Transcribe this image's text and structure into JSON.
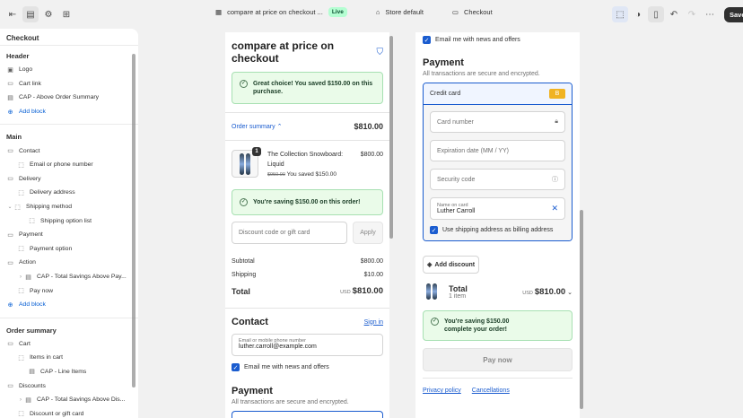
{
  "topbar": {
    "theme_title": "compare at price on checkout ...",
    "live_badge": "Live",
    "store_label": "Store default",
    "page_label": "Checkout",
    "save_label": "Save"
  },
  "sidebar": {
    "title": "Checkout",
    "header_section": "Header",
    "header_items": [
      "Logo",
      "Cart link",
      "CAP - Above Order Summary"
    ],
    "add_block": "Add block",
    "main_section": "Main",
    "contact": "Contact",
    "email_or_phone": "Email or phone number",
    "delivery": "Delivery",
    "delivery_address": "Delivery address",
    "shipping_method": "Shipping method",
    "shipping_option_list": "Shipping option list",
    "payment": "Payment",
    "payment_option": "Payment option",
    "action": "Action",
    "cap_total_above_pay": "CAP - Total Savings Above Pay...",
    "pay_now": "Pay now",
    "order_summary_section": "Order summary",
    "cart": "Cart",
    "items_in_cart": "Items in cart",
    "cap_line_items": "CAP - Line Items",
    "discounts": "Discounts",
    "cap_total_above_dis": "CAP - Total Savings Above Dis...",
    "discount_or_gift": "Discount or gift card"
  },
  "preview_left": {
    "shop_title": "compare at price on checkout",
    "great_choice": "Great choice! You saved $150.00 on this purchase.",
    "order_summary_label": "Order summary",
    "order_summary_total": "$810.00",
    "product_name": "The Collection Snowboard: Liquid",
    "product_price": "$800.00",
    "compare_price": "$950.00",
    "you_saved": "You saved $150.00",
    "qty": "1",
    "saving_msg": "You're saving $150.00 on this order!",
    "discount_placeholder": "Discount code or gift card",
    "apply_label": "Apply",
    "subtotal_label": "Subtotal",
    "subtotal_value": "$800.00",
    "shipping_label": "Shipping",
    "shipping_value": "$10.00",
    "total_label": "Total",
    "currency": "USD",
    "total_value": "$810.00",
    "contact_heading": "Contact",
    "sign_in": "Sign in",
    "email_label": "Email or mobile phone number",
    "email_value": "luther.carroll@example.com",
    "email_offers": "Email me with news and offers",
    "payment_heading": "Payment",
    "payment_sub": "All transactions are secure and encrypted."
  },
  "preview_right": {
    "email_offers": "Email me with news and offers",
    "payment_heading": "Payment",
    "payment_sub": "All transactions are secure and encrypted.",
    "credit_card": "Credit card",
    "card_number": "Card number",
    "expiration": "Expiration date (MM / YY)",
    "security_code": "Security code",
    "name_label": "Name on card",
    "name_value": "Luther Carroll",
    "billing_same": "Use shipping address as billing address",
    "add_discount": "Add discount",
    "total_label": "Total",
    "items_count": "1 item",
    "currency": "USD",
    "total_value": "$810.00",
    "saving_msg": "You're saving $150.00 complete your order!",
    "pay_now": "Pay now",
    "privacy_policy": "Privacy policy",
    "cancellations": "Cancellations"
  },
  "colors": {
    "accent": "#1a5ccf",
    "success_bg": "#eafbe9",
    "save_bg": "#303030"
  }
}
